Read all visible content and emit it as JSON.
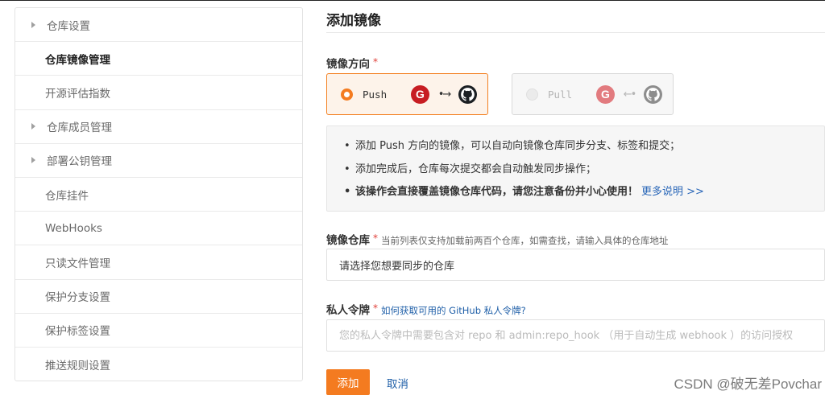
{
  "sidebar": {
    "items": [
      {
        "label": "仓库设置",
        "expandable": true,
        "active": false
      },
      {
        "label": "仓库镜像管理",
        "expandable": false,
        "active": true
      },
      {
        "label": "开源评估指数",
        "expandable": false,
        "active": false
      },
      {
        "label": "仓库成员管理",
        "expandable": true,
        "active": false
      },
      {
        "label": "部署公钥管理",
        "expandable": true,
        "active": false
      },
      {
        "label": "仓库挂件",
        "expandable": false,
        "active": false
      },
      {
        "label": "WebHooks",
        "expandable": false,
        "active": false
      },
      {
        "label": "只读文件管理",
        "expandable": false,
        "active": false
      },
      {
        "label": "保护分支设置",
        "expandable": false,
        "active": false
      },
      {
        "label": "保护标签设置",
        "expandable": false,
        "active": false
      },
      {
        "label": "推送规则设置",
        "expandable": false,
        "active": false
      }
    ]
  },
  "main": {
    "title": "添加镜像",
    "direction": {
      "label": "镜像方向",
      "required": "*",
      "options": [
        {
          "label": "Push",
          "selected": true,
          "disabled": false,
          "arrow": "•→"
        },
        {
          "label": "Pull",
          "selected": false,
          "disabled": true,
          "arrow": "←•"
        }
      ],
      "logo_letter": "G"
    },
    "info": {
      "lines": [
        "添加 Push 方向的镜像，可以自动向镜像仓库同步分支、标签和提交；",
        "添加完成后，仓库每次提交都会自动触发同步操作；"
      ],
      "warning": "该操作会直接覆盖镜像仓库代码，请您注意备份并小心使用！",
      "more_link": "更多说明 >>",
      "bullet": "•"
    },
    "repo": {
      "label": "镜像仓库",
      "required": "*",
      "hint": "当前列表仅支持加载前两百个仓库，如需查找，请输入具体的仓库地址",
      "value": "请选择您想要同步的仓库"
    },
    "token": {
      "label": "私人令牌",
      "required": "*",
      "hint_link": "如何获取可用的 GitHub 私人令牌?",
      "placeholder": "您的私人令牌中需要包含对 repo 和 admin:repo_hook （用于自动生成 webhook ）的访问授权"
    },
    "buttons": {
      "add": "添加",
      "cancel": "取消"
    }
  },
  "watermark": "CSDN @破无差Povchar",
  "colors": {
    "accent": "#f47b20",
    "link": "#1f5fa8",
    "required": "#e0413a",
    "gitee": "#c71d23"
  }
}
